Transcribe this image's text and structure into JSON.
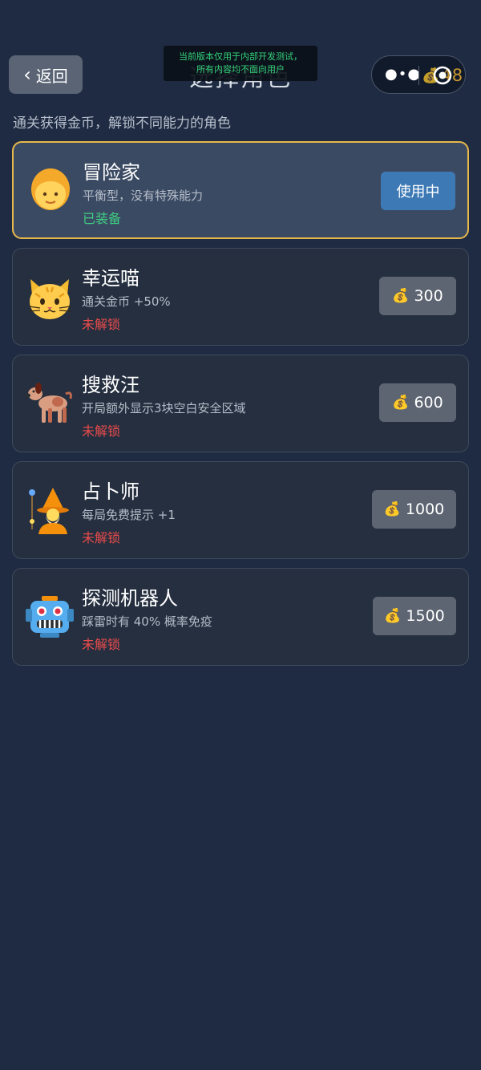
{
  "header": {
    "back_label": "返回",
    "title": "选择角色",
    "debug_banner_line1": "当前版本仅用于内部开发测试，",
    "debug_banner_line2": "所有内容均不面向用户",
    "coin_icon": "money-bag-icon",
    "coin_count": "48"
  },
  "subtitle": "通关获得金币，解锁不同能力的角色",
  "characters": [
    {
      "name": "冒险家",
      "desc": "平衡型，没有特殊能力",
      "status": "已装备",
      "action": "使用中",
      "icon": "blond-person-icon"
    },
    {
      "name": "幸运喵",
      "desc": "通关金币 +50%",
      "status": "未解锁",
      "price": "300",
      "icon": "cat-face-icon"
    },
    {
      "name": "搜救汪",
      "desc": "开局额外显示3块空白安全区域",
      "status": "未解锁",
      "price": "600",
      "icon": "dog-icon"
    },
    {
      "name": "占卜师",
      "desc": "每局免费提示 +1",
      "status": "未解锁",
      "price": "1000",
      "icon": "wizard-icon"
    },
    {
      "name": "探测机器人",
      "desc": "踩雷时有 40% 概率免疫",
      "status": "未解锁",
      "price": "1500",
      "icon": "robot-icon"
    }
  ],
  "colors": {
    "background": "#1e2b42",
    "active_border": "#e8b84a",
    "equipped_text": "#3fcf82",
    "locked_text": "#e94b4b",
    "use_button": "#3d7ab5",
    "price_button": "#5d6572"
  }
}
